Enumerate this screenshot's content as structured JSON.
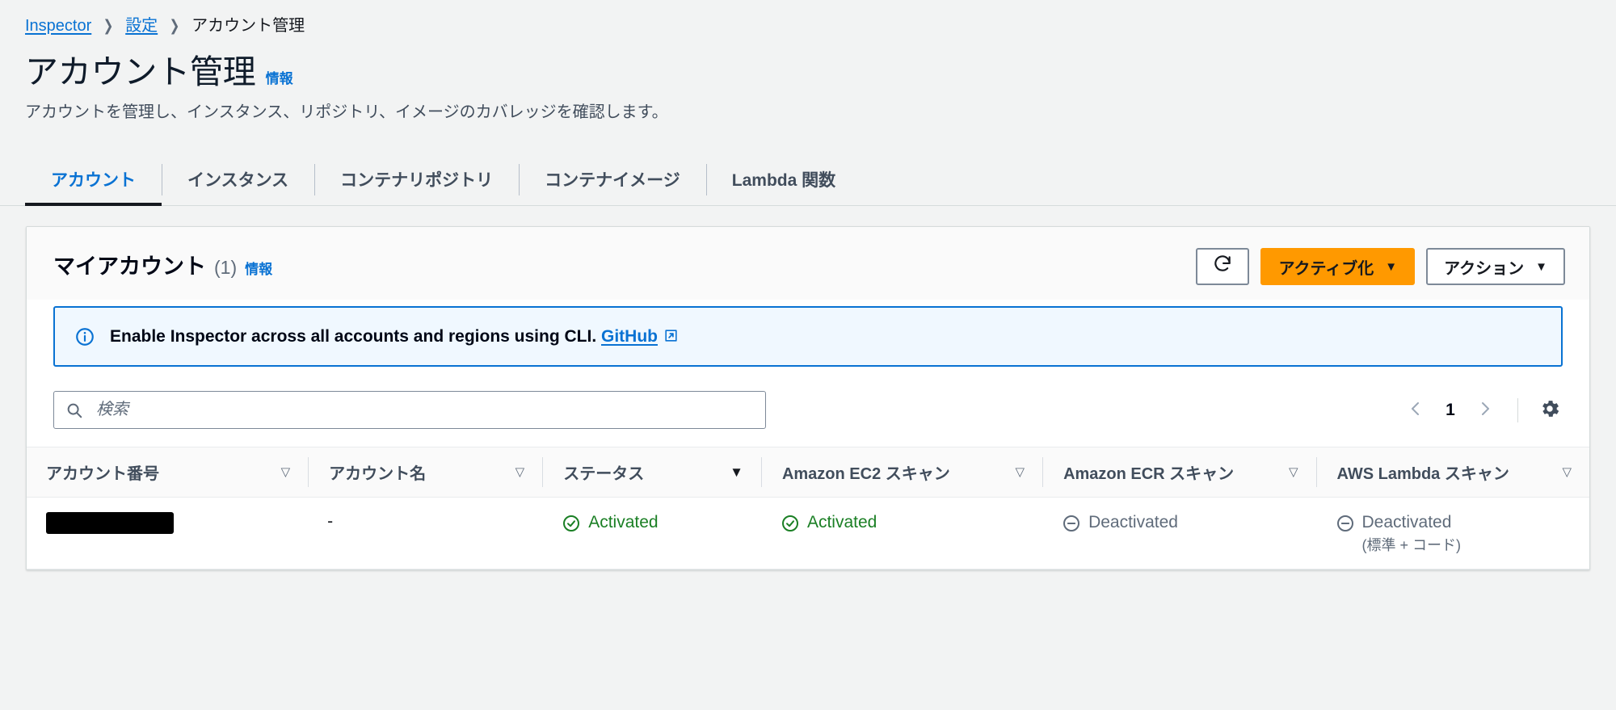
{
  "breadcrumb": {
    "items": [
      {
        "label": "Inspector",
        "type": "link"
      },
      {
        "label": "設定",
        "type": "link"
      },
      {
        "label": "アカウント管理",
        "type": "current"
      }
    ],
    "separator": "❯"
  },
  "page": {
    "title": "アカウント管理",
    "info_label": "情報",
    "description": "アカウントを管理し、インスタンス、リポジトリ、イメージのカバレッジを確認します。"
  },
  "tabs": [
    {
      "label": "アカウント",
      "active": true
    },
    {
      "label": "インスタンス",
      "active": false
    },
    {
      "label": "コンテナリポジトリ",
      "active": false
    },
    {
      "label": "コンテナイメージ",
      "active": false
    },
    {
      "label": "Lambda 関数",
      "active": false
    }
  ],
  "card": {
    "title": "マイアカウント",
    "count": "(1)",
    "info_label": "情報",
    "refresh_icon": "refresh-icon",
    "activate_label": "アクティブ化",
    "activate_caret": "▼",
    "actions_label": "アクション",
    "actions_caret": "▼"
  },
  "alert": {
    "icon": "info-circle-icon",
    "text": "Enable Inspector across all accounts and regions using CLI.",
    "link_label": "GitHub",
    "external_icon": "external-link-icon"
  },
  "search": {
    "icon": "search-icon",
    "placeholder": "検索",
    "value": ""
  },
  "pagination": {
    "prev_icon": "chevron-left-icon",
    "page": "1",
    "next_icon": "chevron-right-icon",
    "settings_icon": "gear-icon"
  },
  "table": {
    "columns": [
      {
        "label": "アカウント番号",
        "sort": "hollow"
      },
      {
        "label": "アカウント名",
        "sort": "hollow"
      },
      {
        "label": "ステータス",
        "sort": "filled"
      },
      {
        "label": "Amazon EC2 スキャン",
        "sort": "hollow"
      },
      {
        "label": "Amazon ECR スキャン",
        "sort": "hollow"
      },
      {
        "label": "AWS Lambda スキャン",
        "sort": "hollow"
      }
    ],
    "sort_caret_hollow": "▽",
    "sort_caret_filled": "▼",
    "rows": [
      {
        "account_id": "",
        "account_id_redacted": true,
        "account_name": "-",
        "status": {
          "text": "Activated",
          "state": "activated",
          "icon": "check-circle-icon"
        },
        "ec2_scan": {
          "text": "Activated",
          "state": "activated",
          "icon": "check-circle-icon"
        },
        "ecr_scan": {
          "text": "Deactivated",
          "state": "deactivated",
          "icon": "minus-circle-icon"
        },
        "lambda_scan": {
          "text": "Deactivated",
          "sub": "(標準 + コード)",
          "state": "deactivated",
          "icon": "minus-circle-icon"
        }
      }
    ]
  },
  "colors": {
    "page_background": "#f2f3f3",
    "accent_link": "#0972d3",
    "primary_button": "#ff9900",
    "status_activated": "#1a7f24",
    "status_deactivated": "#5f6b7a",
    "alert_background": "#f0f8ff"
  }
}
